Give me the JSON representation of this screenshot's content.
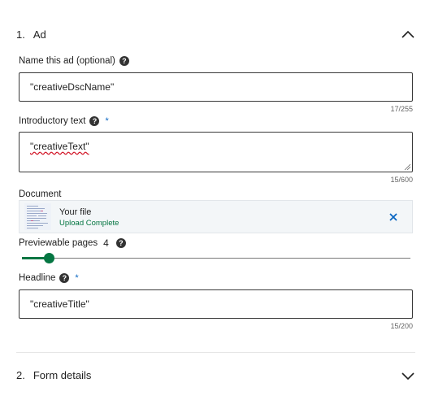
{
  "section1": {
    "number": "1.",
    "title": "Ad"
  },
  "ad_name": {
    "label": "Name this ad (optional)",
    "value": "\"creativeDscName\"",
    "counter": "17/255"
  },
  "intro_text": {
    "label": "Introductory text",
    "required_mark": "*",
    "value": "\"creativeText\"",
    "counter": "15/600"
  },
  "document": {
    "label": "Document",
    "file_name": "Your file",
    "status": "Upload Complete"
  },
  "previewable": {
    "label": "Previewable pages",
    "value": "4",
    "fraction": 0.07
  },
  "headline": {
    "label": "Headline",
    "required_mark": "*",
    "value": "\"creativeTitle\"",
    "counter": "15/200"
  },
  "section2": {
    "number": "2.",
    "title": "Form details"
  },
  "colors": {
    "accent_green": "#057642",
    "required_blue": "#0a66c2",
    "close_blue": "#0a66c2"
  },
  "icons": {
    "collapse": "chevron-up-icon",
    "expand": "chevron-down-icon",
    "help": "question-circle-icon",
    "remove": "close-icon"
  }
}
